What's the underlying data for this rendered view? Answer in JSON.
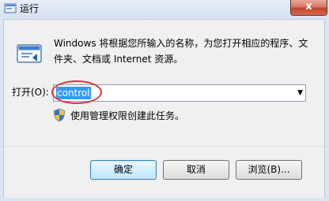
{
  "window": {
    "title": "运行",
    "close_glyph": "x",
    "app_icon": "run-icon",
    "close_icon": "close-icon"
  },
  "dialog": {
    "description": "Windows 将根据您所输入的名称，为您打开相应的程序、文件夹、文档或 Internet 资源。",
    "open_label": "打开(O):",
    "command_value": "control",
    "admin_note": "使用管理权限创建此任务。",
    "big_icon": "run-program-icon",
    "shield_icon": "uac-shield-icon",
    "dropdown_icon": "chevron-down-icon",
    "dropdown_glyph": "▼"
  },
  "buttons": {
    "ok": "确定",
    "cancel": "取消",
    "browse": "浏览(B)..."
  },
  "colors": {
    "selection": "#3399ff",
    "annotation_circle": "#d9363e",
    "title_bar": "#d7e2f1",
    "close_button": "#c1432c"
  }
}
